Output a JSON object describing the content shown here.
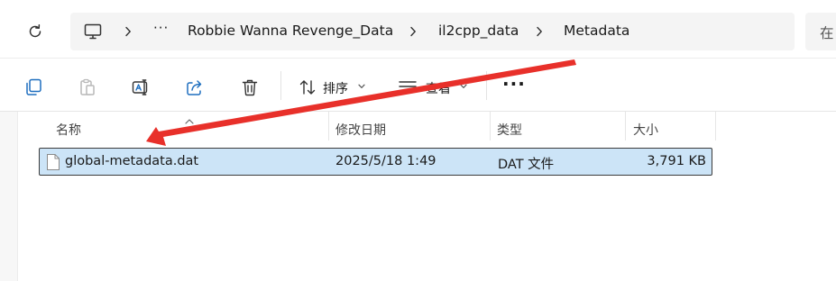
{
  "address_bar": {
    "more_label": "···",
    "crumbs": [
      "Robbie Wanna Revenge_Data",
      "il2cpp_data",
      "Metadata"
    ],
    "search_hint": "在"
  },
  "toolbar": {
    "sort_label": "排序",
    "view_label": "查看",
    "more_label": "···"
  },
  "file_list": {
    "columns": [
      "名称",
      "修改日期",
      "类型",
      "大小"
    ],
    "rows": [
      {
        "name": "global-metadata.dat",
        "modified": "2025/5/18 1:49",
        "type": "DAT 文件",
        "size": "3,791 KB",
        "selected": true
      }
    ]
  },
  "colors": {
    "selection": "#cce4f7",
    "annotation_arrow": "#e8302a",
    "accent_icon": "#1f6fbf"
  }
}
